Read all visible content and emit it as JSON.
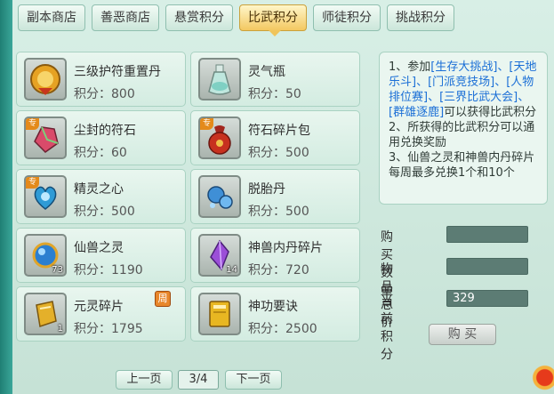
{
  "tabs": [
    {
      "label": "副本商店",
      "active": false
    },
    {
      "label": "善恶商店",
      "active": false
    },
    {
      "label": "悬赏积分",
      "active": false
    },
    {
      "label": "比武积分",
      "active": true
    },
    {
      "label": "师徒积分",
      "active": false
    },
    {
      "label": "挑战积分",
      "active": false
    }
  ],
  "items": [
    {
      "name": "三级护符重置丹",
      "price": "积分：800",
      "icon": "gold-amulet-icon"
    },
    {
      "name": "灵气瓶",
      "price": "积分：50",
      "icon": "potion-bottle-icon"
    },
    {
      "name": "尘封的符石",
      "price": "积分：60",
      "icon": "runestone-icon",
      "badge": "专"
    },
    {
      "name": "符石碎片包",
      "price": "积分：500",
      "icon": "red-pouch-icon",
      "badge": "专"
    },
    {
      "name": "精灵之心",
      "price": "积分：500",
      "icon": "spirit-heart-icon",
      "badge": "专"
    },
    {
      "name": "脱胎丹",
      "price": "积分：500",
      "icon": "blue-pill-icon"
    },
    {
      "name": "仙兽之灵",
      "price": "积分：1190",
      "icon": "blue-orb-icon",
      "count": "73"
    },
    {
      "name": "神兽内丹碎片",
      "price": "积分：720",
      "icon": "purple-crystal-icon",
      "count": "14"
    },
    {
      "name": "元灵碎片",
      "price": "积分：1795",
      "icon": "gold-shard-icon",
      "count": "1",
      "tag": "周"
    },
    {
      "name": "神功要诀",
      "price": "积分：2500",
      "icon": "golden-book-icon"
    }
  ],
  "info": {
    "line1a": "1、参加",
    "line1b": "[生存大挑战]、[天地乐斗]、[门派竞技场]、[人物排位赛]、[三界比武大会]、[群雄逐鹿]",
    "line1c": "可以获得比武积分",
    "line2": "2、所获得的比武积分可以通用兑换奖励",
    "line3": "3、仙兽之灵和神兽内丹碎片每周最多兑换1个和10个"
  },
  "form": {
    "qty_label": "购买数量",
    "qty_value": "",
    "total_label": "物品总价",
    "total_value": "",
    "points_label": "当前积分",
    "points_value": "329"
  },
  "buy_label": "购 买",
  "pager": {
    "prev": "上一页",
    "indicator": "3/4",
    "next": "下一页"
  }
}
